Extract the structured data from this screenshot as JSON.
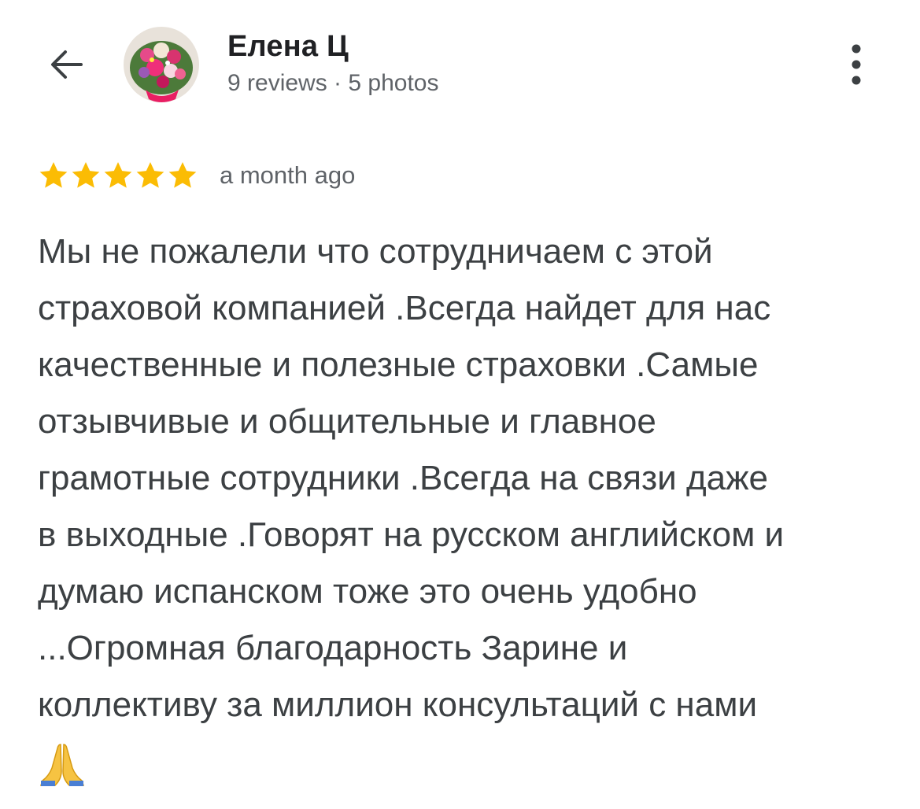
{
  "header": {
    "back_icon": "arrow-left-icon",
    "author_name": "Елена Ц",
    "author_meta": "9 reviews · 5 photos",
    "avatar_icon": "flower-bouquet-avatar",
    "more_icon": "more-vert-icon"
  },
  "review": {
    "rating": 5,
    "rating_max": 5,
    "star_color": "#fbbc04",
    "date": "a month ago",
    "lines": [
      "Мы не пожалели что сотрудничаем с этой",
      "страховой компанией .Всегда найдет для нас",
      "качественные и полезные страховки .Самые",
      "отзывчивые и общительные и главное",
      "грамотные сотрудники .Всегда на связи даже",
      "в выходные .Говорят на русском английском и",
      "думаю испанском тоже это очень удобно",
      "...Огромная благодарность Зарине и",
      "коллективу за миллион консультаций с нами"
    ],
    "emoji_icon": "folded-hands-icon"
  }
}
